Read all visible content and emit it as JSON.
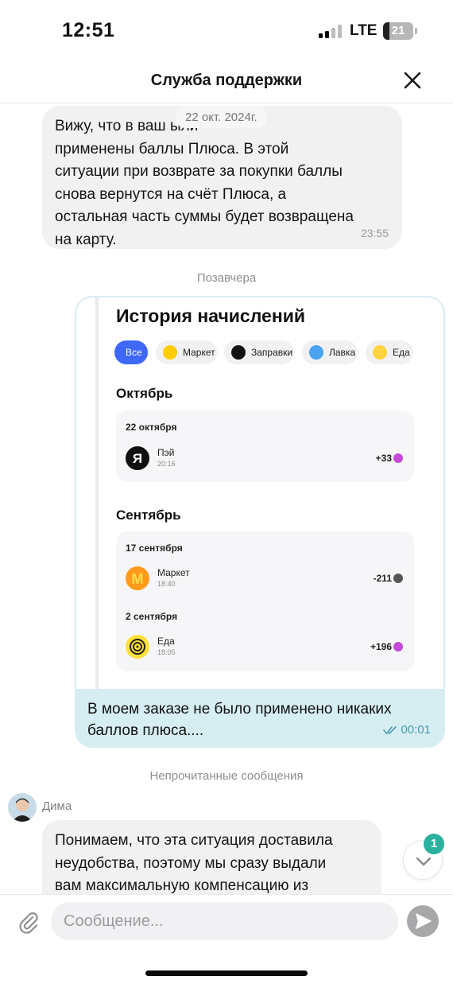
{
  "status_bar": {
    "time": "12:51",
    "network": "LTE",
    "battery": "21"
  },
  "header": {
    "title": "Служба поддержки",
    "close_icon": "close-icon"
  },
  "chat": {
    "message1": {
      "text": "Вижу, что в ваш           ыли\nприменены баллы Плюса. В этой\nситуации при возврате за покупки баллы\nснова вернутся на счёт Плюса, а\nостальная часть суммы будет возвращена\nна карту.",
      "time": "23:55",
      "date_chip": "22 окт. 2024г."
    },
    "divider_day": "Позавчера",
    "screenshot": {
      "title": "История начислений",
      "filters": [
        {
          "label": "Все",
          "active": true
        },
        {
          "label": "Маркет",
          "icon": "market-icon",
          "color": "#ffcc00"
        },
        {
          "label": "Заправки",
          "icon": "fuel-icon",
          "color": "#000000"
        },
        {
          "label": "Лавка",
          "icon": "lavka-icon",
          "color": "#4aa3f0"
        },
        {
          "label": "Еда",
          "icon": "eda-icon",
          "color": "#ffd33d"
        }
      ],
      "months": [
        {
          "name": "Октябрь",
          "groups": [
            {
              "date": "22 октября",
              "ops": [
                {
                  "name": "Пэй",
                  "time": "20:16",
                  "amount": "+33"
                }
              ]
            }
          ]
        },
        {
          "name": "Сентябрь",
          "groups": [
            {
              "date": "17 сентября",
              "ops": [
                {
                  "name": "Маркет",
                  "time": "18:40",
                  "amount": "-211"
                }
              ]
            },
            {
              "date": "2 сентября",
              "ops": [
                {
                  "name": "Еда",
                  "time": "18:05",
                  "amount": "+196"
                }
              ]
            }
          ]
        }
      ]
    },
    "outgoing": {
      "text": "В моем заказе не было применено никаких\nбаллов плюса....",
      "time": "00:01",
      "status_icon": "double-check-icon"
    },
    "divider_unread": "Непрочитанные сообщения",
    "agent": {
      "name": "Дима",
      "text": "Понимаем, что эта ситуация доставила\nнеудобства, поэтому мы сразу выдали\nвам максимальную компенсацию из"
    },
    "unread_count": "1"
  },
  "composer": {
    "placeholder": "Сообщение...",
    "attach_icon": "paperclip-icon",
    "send_icon": "send-icon"
  },
  "colors": {
    "outgoing_bubble": "#d6eef2",
    "incoming_bubble": "#f1f1f2",
    "accent": "#3e68f5",
    "badge": "#2bb1a0"
  }
}
